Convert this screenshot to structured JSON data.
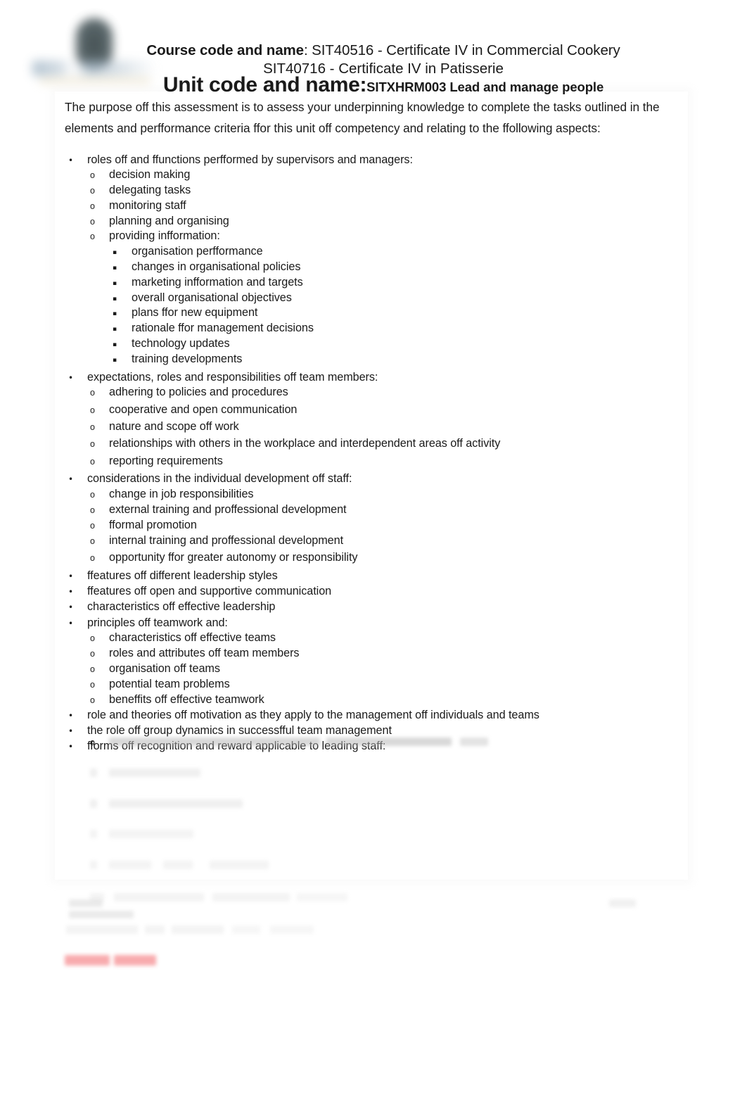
{
  "document": {
    "header": {
      "logo_name": "institute-logo",
      "course_label": "Course code and name",
      "course_separator": ": ",
      "course_value_line1": "SIT40516 - Certificate IV in Commercial Cookery",
      "course_value_line2": "SIT40716 - Certificate IV in Patisserie",
      "unit_label": "Unit code and name:",
      "unit_value": "SITXHRM003 Lead and manage people"
    },
    "intro": "The purpose off this assessment is to assess your underpinning knowledge to complete the tasks outlined in the elements and perfformance criteria ffor this unit off competency and relating to the ffollowing aspects:",
    "markers": {
      "bullet": "•",
      "circle": "o",
      "square": "▪"
    },
    "list": [
      {
        "level": 1,
        "text": "roles off and ffunctions perfformed by supervisors and managers:"
      },
      {
        "level": 2,
        "text": "decision making"
      },
      {
        "level": 2,
        "text": "delegating tasks"
      },
      {
        "level": 2,
        "text": "monitoring staff"
      },
      {
        "level": 2,
        "text": "planning and organising"
      },
      {
        "level": 2,
        "text": "providing infformation:"
      },
      {
        "level": 3,
        "text": "organisation perfformance"
      },
      {
        "level": 3,
        "text": "changes in organisational policies"
      },
      {
        "level": 3,
        "text": "marketing infformation and targets"
      },
      {
        "level": 3,
        "text": "overall organisational objectives"
      },
      {
        "level": 3,
        "text": "plans ffor new equipment"
      },
      {
        "level": 3,
        "text": "rationale ffor management decisions"
      },
      {
        "level": 3,
        "text": "technology updates"
      },
      {
        "level": 3,
        "text": "training developments"
      },
      {
        "level": 1,
        "text": "expectations, roles and responsibilities off team members:"
      },
      {
        "level": 2,
        "text": "adhering to policies and procedures"
      },
      {
        "level": 2,
        "text": "cooperative and open communication"
      },
      {
        "level": 2,
        "text": "nature and scope off work"
      },
      {
        "level": 2,
        "text": "relationships with others in the workplace and interdependent areas off activity"
      },
      {
        "level": 2,
        "text": "reporting requirements"
      },
      {
        "level": 1,
        "text": "considerations in the individual development off staff:"
      },
      {
        "level": 2,
        "text": "change in job responsibilities"
      },
      {
        "level": 2,
        "text": "external training and proffessional development"
      },
      {
        "level": 2,
        "text": "fformal promotion"
      },
      {
        "level": 2,
        "text": "internal training and proffessional development"
      },
      {
        "level": 2,
        "text": "opportunity ffor greater autonomy or responsibility"
      },
      {
        "level": 1,
        "text": "ffeatures off different leadership styles"
      },
      {
        "level": 1,
        "text": "ffeatures off open and supportive communication"
      },
      {
        "level": 1,
        "text": "characteristics off effective leadership"
      },
      {
        "level": 1,
        "text": "principles off teamwork and:"
      },
      {
        "level": 2,
        "text": "characteristics off effective teams"
      },
      {
        "level": 2,
        "text": "roles and attributes off team members"
      },
      {
        "level": 2,
        "text": "organisation off teams"
      },
      {
        "level": 2,
        "text": "potential team problems"
      },
      {
        "level": 2,
        "text": "beneffits off effective teamwork"
      },
      {
        "level": 1,
        "text": "role and theories off motivation as they apply to the management off individuals and teams"
      },
      {
        "level": 1,
        "text": "the role off group dynamics in successfful team management"
      },
      {
        "level": 1,
        "text": "fforms off recognition and reward applicable to leading staff:"
      }
    ],
    "illegible_note": "Remaining sub-items, trailing paragraph, highlighted red text and page footer are blurred beyond legibility in the source image.",
    "colors": {
      "text": "#1a1a1a",
      "page_background": "#ffffff",
      "highlight_red": "#f4787c",
      "logo_blue_grey": "#8ca5b9"
    }
  }
}
